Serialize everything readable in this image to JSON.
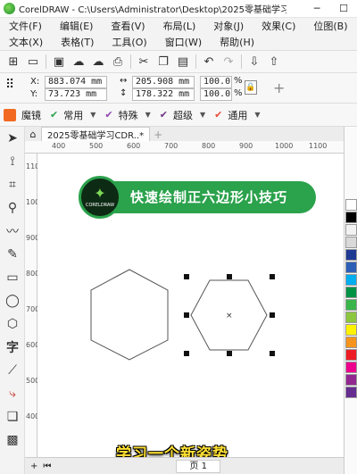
{
  "window": {
    "title": "CorelDRAW - C:\\Users\\Administrator\\Desktop\\2025零基础学习...",
    "controls": [
      "─",
      "☐"
    ]
  },
  "menu": {
    "row1": [
      "文件(F)",
      "编辑(E)",
      "查看(V)",
      "布局(L)",
      "对象(J)",
      "效果(C)",
      "位图(B)"
    ],
    "row2": [
      "文本(X)",
      "表格(T)",
      "工具(O)",
      "窗口(W)",
      "帮助(H)"
    ]
  },
  "propbar": {
    "x_label": "X:",
    "x_value": "883.074 mm",
    "y_label": "Y:",
    "y_value": "73.723 mm",
    "w_value": "205.908 mm",
    "h_value": "178.322 mm",
    "sx_value": "100.0",
    "sy_value": "100.0",
    "pct": "%"
  },
  "presets": {
    "brand": "魔镜",
    "items": [
      "常用",
      "特殊",
      "超级",
      "通用"
    ]
  },
  "doc": {
    "tab_label": "2025零基础学习CDR..*",
    "ruler_h": [
      "400",
      "500",
      "600",
      "700",
      "800",
      "900",
      "1000",
      "1100",
      "1200"
    ],
    "ruler_v": [
      "1100",
      "1000",
      "900",
      "800",
      "700",
      "600",
      "500",
      "400",
      "300"
    ]
  },
  "banner": {
    "logo_brand": "CORELDRAW",
    "text": "快速绘制正六边形小技巧"
  },
  "caption": "学习一个新姿势",
  "bottom": {
    "page_label": "页 1"
  },
  "palette_colors": [
    "#ffffff",
    "#000000",
    "#f2f2f2",
    "#d9d9d9",
    "#1f3a93",
    "#2e5fb7",
    "#00aeef",
    "#009245",
    "#39b54a",
    "#8dc63f",
    "#fff200",
    "#f7941d",
    "#ed1c24",
    "#ec008c",
    "#92278f",
    "#662d91"
  ],
  "accent": "#2ba24c"
}
